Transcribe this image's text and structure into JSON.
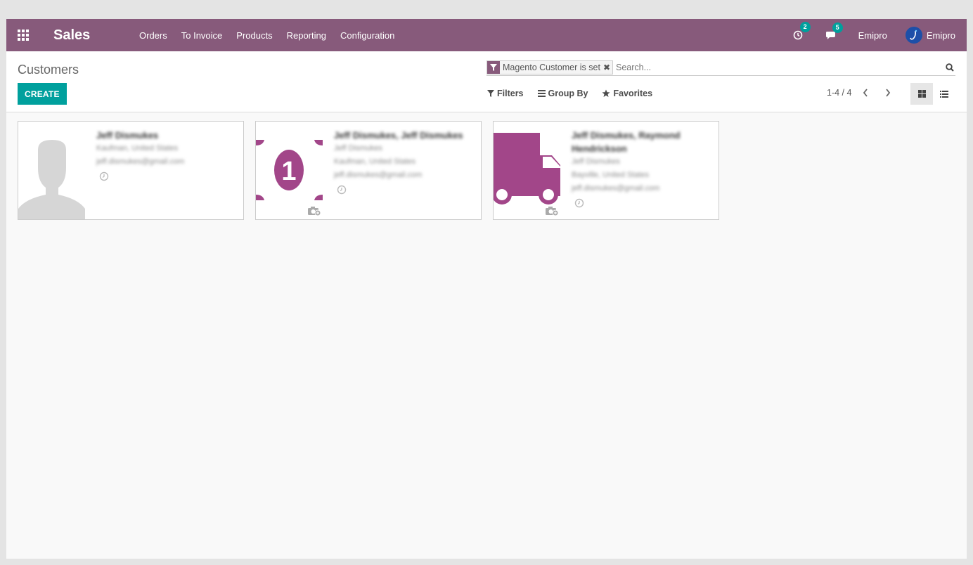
{
  "navbar": {
    "app_name": "Sales",
    "menu": [
      "Orders",
      "To Invoice",
      "Products",
      "Reporting",
      "Configuration"
    ],
    "activity_count": "2",
    "message_count": "5",
    "company": "Emipro",
    "user": "Emipro"
  },
  "control_panel": {
    "breadcrumb": "Customers",
    "create_label": "CREATE",
    "facet_value": "Magento Customer is set",
    "search_placeholder": "Search...",
    "filters_label": "Filters",
    "group_by_label": "Group By",
    "favorites_label": "Favorites",
    "pager": "1-4 / 4"
  },
  "cards": [
    {
      "name": "Jeff Dismukes",
      "lines": [
        "Kaufman, United States",
        "jeff.dismukes@gmail.com"
      ],
      "image": "person-placeholder"
    },
    {
      "name": "Jeff Dismukes, Jeff Dismukes",
      "lines": [
        "Jeff Dismukes",
        "Kaufman, United States",
        "jeff.dismukes@gmail.com"
      ],
      "image": "money-icon"
    },
    {
      "name": "Jeff Dismukes, Raymond Hendrickson",
      "lines": [
        "Jeff Dismukes",
        "Bayville, United States",
        "jeff.dismukes@gmail.com"
      ],
      "image": "truck-icon"
    }
  ],
  "colors": {
    "primary": "#875a7b",
    "accent": "#00a09d"
  }
}
